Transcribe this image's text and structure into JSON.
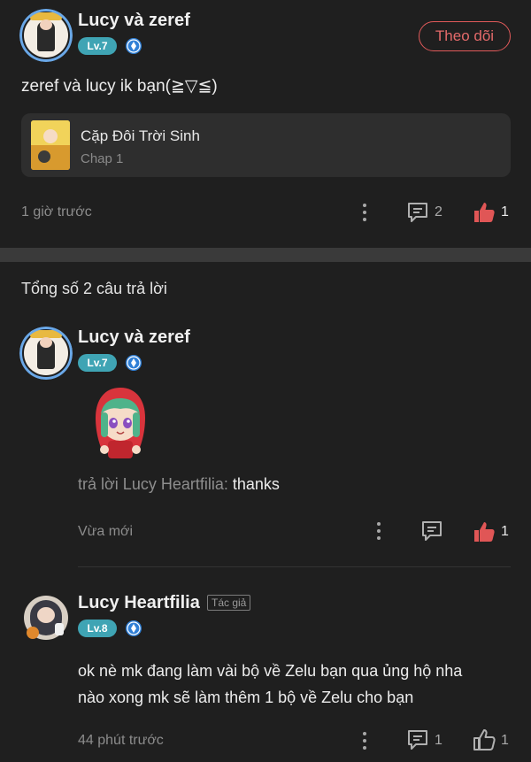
{
  "post": {
    "author": {
      "name": "Lucy và zeref",
      "level": "Lv.7"
    },
    "follow_label": "Theo dõi",
    "text": "zeref và lucy ik bạn(≧▽≦)",
    "manga": {
      "title": "Cặp Đôi Trời Sinh",
      "chapter": "Chap 1"
    },
    "time": "1 giờ trước",
    "comment_count": "2",
    "like_count": "1"
  },
  "replies_header": "Tổng số 2 câu trả lời",
  "replies": [
    {
      "author": {
        "name": "Lucy và zeref",
        "level": "Lv.7"
      },
      "sticker": "red-hood-girl-sticker",
      "reply_prefix": "trả lời Lucy Heartfilia:",
      "reply_body": " thanks",
      "time": "Vừa mới",
      "like_count": "1"
    },
    {
      "author": {
        "name": "Lucy Heartfilia",
        "level": "Lv.8",
        "tag": "Tác giả"
      },
      "text_lines": [
        "ok nè mk đang làm vài bộ về Zelu bạn qua ủng hộ nha",
        "nào xong mk sẽ làm thêm 1 bộ về Zelu cho bạn"
      ],
      "time": "44 phút trước",
      "comment_count": "1",
      "like_count": "1"
    }
  ],
  "colors": {
    "background": "#1f1f1f",
    "accent_red": "#e15a5a",
    "level_badge": "#3fa4b4",
    "shield_badge": "#2f7fd6",
    "muted_text": "#8c8c8c"
  }
}
